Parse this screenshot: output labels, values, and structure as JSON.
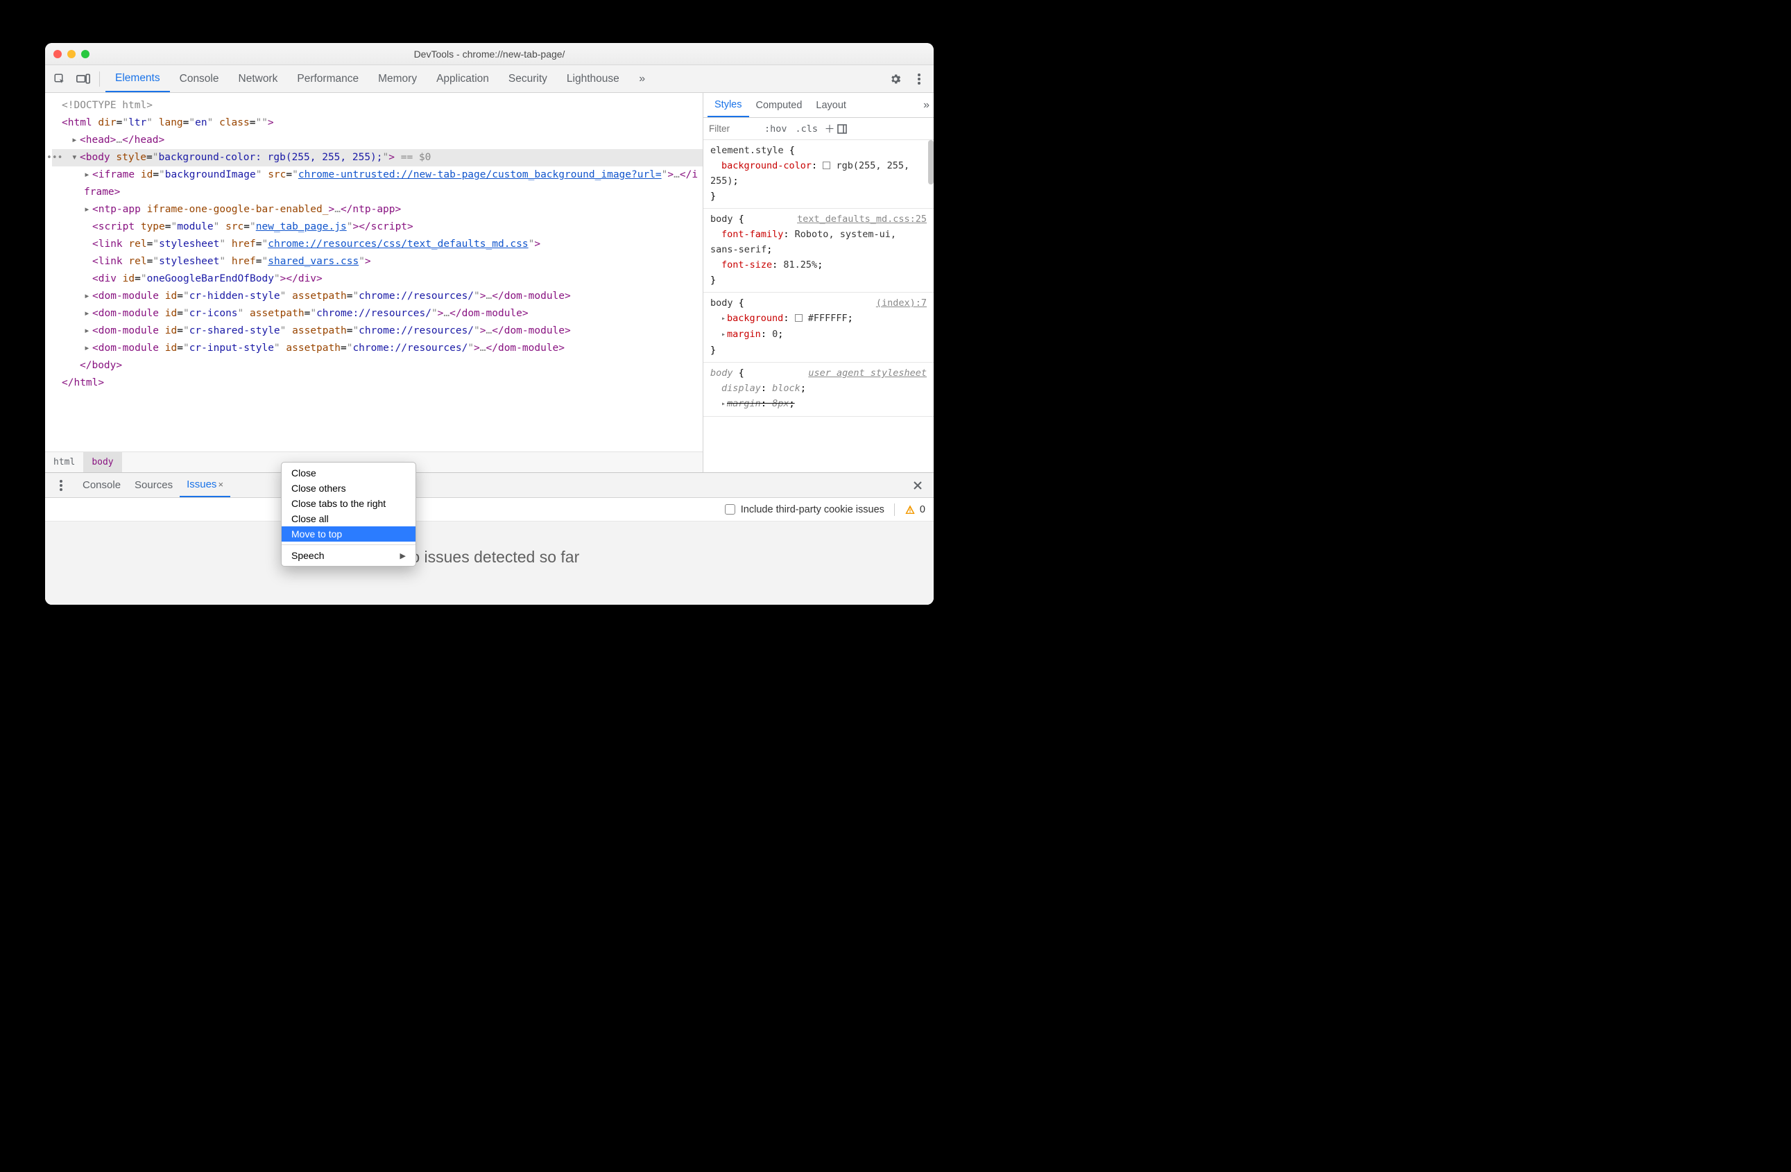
{
  "window": {
    "title": "DevTools - chrome://new-tab-page/"
  },
  "tabs": {
    "items": [
      "Elements",
      "Console",
      "Network",
      "Performance",
      "Memory",
      "Application",
      "Security",
      "Lighthouse"
    ],
    "activeIndex": 0
  },
  "dom": {
    "gutter_dots": "•••",
    "doctype": "<!DOCTYPE html>",
    "html_open": {
      "tag": "html",
      "attrs": [
        {
          "n": "dir",
          "v": "ltr"
        },
        {
          "n": "lang",
          "v": "en"
        },
        {
          "n": "class",
          "v": ""
        }
      ]
    },
    "head_collapsed": {
      "tag": "head",
      "ell": "…"
    },
    "body_row": {
      "tag": "body",
      "attrs": [
        {
          "n": "style",
          "v": "background-color: rgb(255, 255, 255);"
        }
      ],
      "suffix": " == $0"
    },
    "children": [
      {
        "type": "iframe",
        "attrs": [
          {
            "n": "id",
            "v": "backgroundImage"
          },
          {
            "n": "src",
            "v": "chrome-untrusted://new-tab-page/custom_background_image?url=",
            "link": true
          }
        ],
        "ell": "…",
        "close": "iframe"
      },
      {
        "type": "ntp-app",
        "rawattr": "iframe-one-google-bar-enabled_",
        "ell": "…",
        "close": "ntp-app"
      },
      {
        "type": "script",
        "attrs": [
          {
            "n": "type",
            "v": "module"
          },
          {
            "n": "src",
            "v": "new_tab_page.js",
            "link": true
          }
        ],
        "close": "script"
      },
      {
        "type": "link",
        "attrs": [
          {
            "n": "rel",
            "v": "stylesheet"
          },
          {
            "n": "href",
            "v": "chrome://resources/css/text_defaults_md.css",
            "link": true
          }
        ]
      },
      {
        "type": "link",
        "attrs": [
          {
            "n": "rel",
            "v": "stylesheet"
          },
          {
            "n": "href",
            "v": "shared_vars.css",
            "link": true
          }
        ]
      },
      {
        "type": "div",
        "attrs": [
          {
            "n": "id",
            "v": "oneGoogleBarEndOfBody"
          }
        ],
        "close": "div"
      },
      {
        "type": "dom-module",
        "attrs": [
          {
            "n": "id",
            "v": "cr-hidden-style"
          },
          {
            "n": "assetpath",
            "v": "chrome://resources/"
          }
        ],
        "ell": "…",
        "close": "dom-module"
      },
      {
        "type": "dom-module",
        "attrs": [
          {
            "n": "id",
            "v": "cr-icons"
          },
          {
            "n": "assetpath",
            "v": "chrome://resources/"
          }
        ],
        "ell": "…",
        "close": "dom-module"
      },
      {
        "type": "dom-module",
        "attrs": [
          {
            "n": "id",
            "v": "cr-shared-style"
          },
          {
            "n": "assetpath",
            "v": "chrome://resources/"
          }
        ],
        "ell": "…",
        "close": "dom-module"
      },
      {
        "type": "dom-module",
        "attrs": [
          {
            "n": "id",
            "v": "cr-input-style"
          },
          {
            "n": "assetpath",
            "v": "chrome://resources/"
          }
        ],
        "ell": "…",
        "close": "dom-module"
      }
    ],
    "body_close": "body",
    "html_close": "html"
  },
  "breadcrumbs": [
    "html",
    "body"
  ],
  "stylesTabs": {
    "items": [
      "Styles",
      "Computed",
      "Layout"
    ],
    "activeIndex": 0
  },
  "filter": {
    "placeholder": "Filter",
    "hov": ":hov",
    "cls": ".cls"
  },
  "styleRules": [
    {
      "selector": "element.style",
      "brace": "{",
      "props": [
        {
          "n": "background-color",
          "v": "rgb(255, 255, 255)",
          "swatch": "white"
        }
      ],
      "braceClose": "}"
    },
    {
      "selector": "body",
      "src": "text_defaults_md.css:25",
      "brace": "{",
      "props": [
        {
          "n": "font-family",
          "v": "Roboto, system-ui, sans-serif"
        },
        {
          "n": "font-size",
          "v": "81.25%"
        }
      ],
      "braceClose": "}"
    },
    {
      "selector": "body",
      "src": "(index):7",
      "brace": "{",
      "props": [
        {
          "n": "background",
          "v": "#FFFFFF",
          "swatch": "white",
          "expand": true
        },
        {
          "n": "margin",
          "v": "0",
          "expand": true
        }
      ],
      "braceClose": "}"
    },
    {
      "selector": "body",
      "src": "user agent stylesheet",
      "srcItalic": true,
      "brace": "{",
      "selItalic": true,
      "props": [
        {
          "n": "display",
          "v": "block",
          "italic": true
        },
        {
          "n": "margin",
          "v": "8px",
          "italic": true,
          "expand": true,
          "strike": true
        }
      ],
      "noClose": true
    }
  ],
  "drawerTabs": {
    "items": [
      "Console",
      "Sources",
      "Issues"
    ],
    "activeIndex": 2
  },
  "issues": {
    "checkLabel": "Include third-party cookie issues",
    "count": "0",
    "empty": "No issues detected so far"
  },
  "contextMenu": {
    "items": [
      {
        "label": "Close"
      },
      {
        "label": "Close others"
      },
      {
        "label": "Close tabs to the right"
      },
      {
        "label": "Close all"
      },
      {
        "label": "Move to top",
        "highlight": true
      }
    ],
    "sepAfter": 4,
    "footer": {
      "label": "Speech",
      "submenu": true
    }
  }
}
